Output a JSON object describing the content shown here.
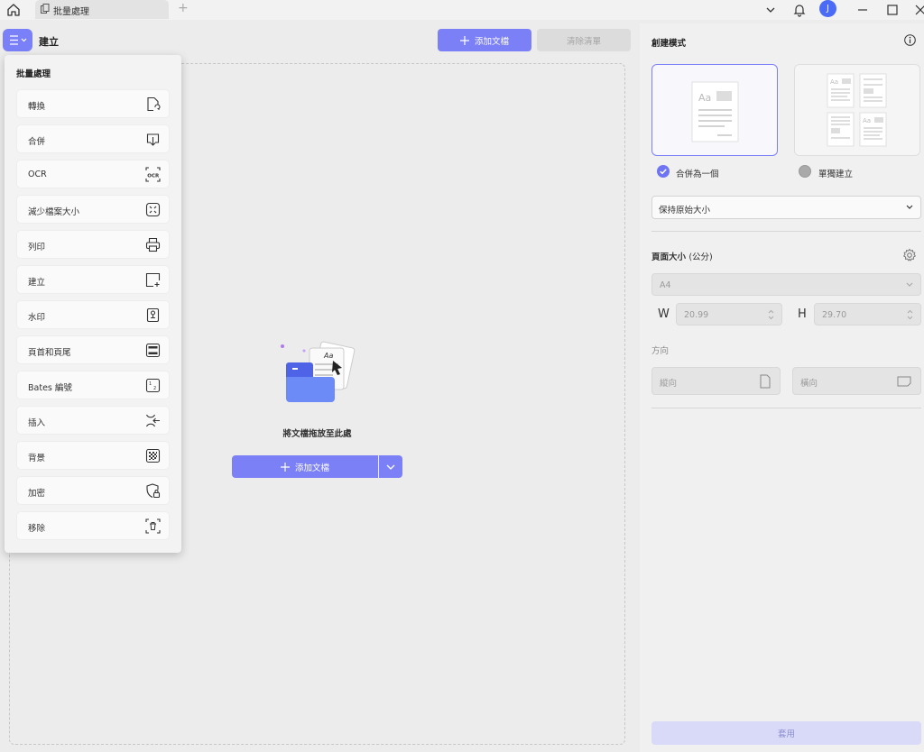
{
  "titlebar": {
    "tab_label": "批量處理",
    "new_tab": "+",
    "avatar_letter": "J",
    "icons": [
      "home-icon",
      "chevron-down-icon",
      "bell-icon",
      "minimize-icon",
      "maximize-icon",
      "close-icon"
    ]
  },
  "toolbar": {
    "title": "建立",
    "add_files": "添加文檔",
    "clear_list": "清除清單"
  },
  "dropzone": {
    "hint": "將文檔拖放至此處",
    "add_files": "添加文檔"
  },
  "menu": {
    "heading": "批量處理",
    "items": [
      {
        "label": "轉換",
        "icon": "convert-icon"
      },
      {
        "label": "合併",
        "icon": "merge-icon"
      },
      {
        "label": "OCR",
        "icon": "ocr-icon"
      },
      {
        "label": "減少檔案大小",
        "icon": "compress-icon"
      },
      {
        "label": "列印",
        "icon": "print-icon"
      },
      {
        "label": "建立",
        "icon": "create-icon"
      },
      {
        "label": "水印",
        "icon": "watermark-icon"
      },
      {
        "label": "頁首和頁尾",
        "icon": "header-footer-icon"
      },
      {
        "label": "Bates 編號",
        "icon": "bates-icon"
      },
      {
        "label": "插入",
        "icon": "insert-icon"
      },
      {
        "label": "背景",
        "icon": "background-icon"
      },
      {
        "label": "加密",
        "icon": "encrypt-icon"
      },
      {
        "label": "移除",
        "icon": "remove-icon"
      }
    ]
  },
  "panel": {
    "title": "創建模式",
    "option_merge": "合併為一個",
    "option_separate": "單獨建立",
    "size_select": "保持原始大小",
    "page_size_title": "頁面大小",
    "page_size_unit": "(公分)",
    "paper": "A4",
    "w_label": "W",
    "w_value": "20.99",
    "h_label": "H",
    "h_value": "29.70",
    "orientation_title": "方向",
    "portrait": "縱向",
    "landscape": "橫向",
    "apply": "套用",
    "accent": "#7c80f7"
  }
}
